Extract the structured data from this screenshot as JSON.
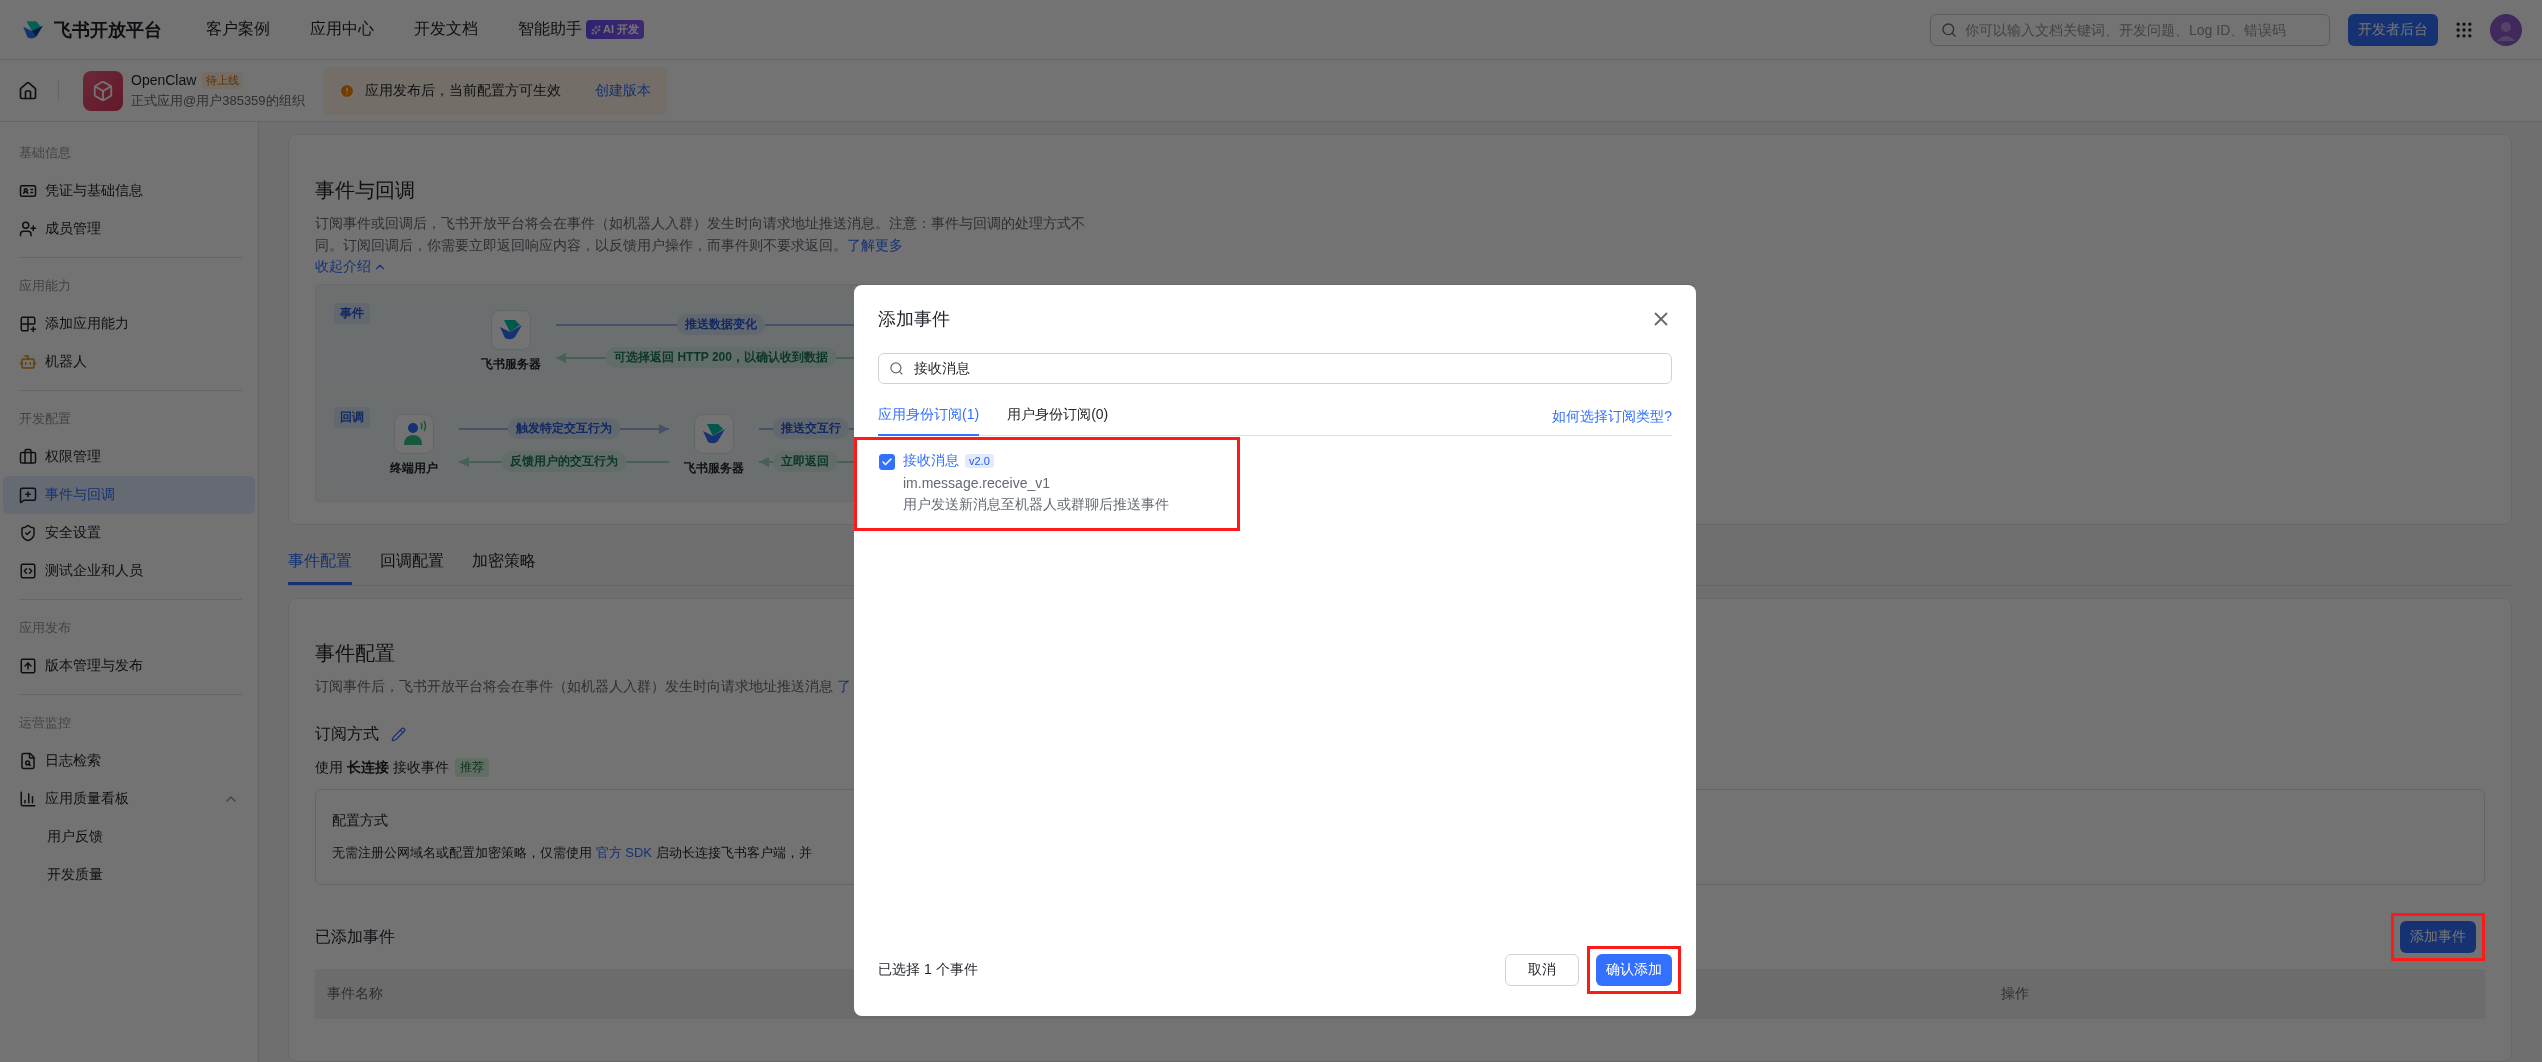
{
  "topbar": {
    "logo": "飞书开放平台",
    "nav": [
      {
        "label": "客户案例"
      },
      {
        "label": "应用中心"
      },
      {
        "label": "开发文档"
      },
      {
        "label": "智能助手",
        "badge": "AI 开发"
      }
    ],
    "search": {
      "placeholder": "你可以输入文档关键词、开发问题、Log ID、错误码"
    },
    "console_button": "开发者后台"
  },
  "app_header": {
    "app_name": "OpenClaw",
    "status": "待上线",
    "org": "正式应用@用户385359的组织",
    "notice": "应用发布后，当前配置方可生效",
    "notice_link": "创建版本"
  },
  "sidebar": {
    "sections": [
      {
        "title": "基础信息",
        "items": [
          {
            "label": "凭证与基础信息",
            "selected": false
          },
          {
            "label": "成员管理",
            "selected": false
          }
        ]
      },
      {
        "title": "应用能力",
        "items": [
          {
            "label": "添加应用能力",
            "selected": false
          },
          {
            "label": "机器人",
            "selected": false
          }
        ]
      },
      {
        "title": "开发配置",
        "items": [
          {
            "label": "权限管理",
            "selected": false
          },
          {
            "label": "事件与回调",
            "selected": true
          },
          {
            "label": "安全设置",
            "selected": false
          },
          {
            "label": "测试企业和人员",
            "selected": false
          }
        ]
      },
      {
        "title": "应用发布",
        "items": [
          {
            "label": "版本管理与发布",
            "selected": false
          }
        ]
      },
      {
        "title": "运营监控",
        "items": [
          {
            "label": "日志检索",
            "selected": false
          },
          {
            "label": "应用质量看板",
            "selected": false,
            "expanded": true,
            "children": [
              {
                "label": "用户反馈",
                "selected": false
              },
              {
                "label": "开发质量",
                "selected": false
              }
            ]
          }
        ]
      }
    ]
  },
  "intro_card": {
    "title": "事件与回调",
    "description": "订阅事件或回调后，飞书开放平台将会在事件（如机器人入群）发生时向请求地址推送消息。注意：事件与回调的处理方式不同。订阅回调后，你需要立即返回响应内容，以反馈用户操作，而事件则不要求返回。",
    "learn_more": "了解更多",
    "collapse_link": "收起介绍",
    "diagram": [
      {
        "tag": "事件",
        "steps": [
          {
            "kind": "server",
            "label": "飞书服务器"
          },
          {
            "kind": "arrows",
            "forward": "推送数据变化",
            "back": "可选择返回 HTTP 200，以确认收到数据"
          }
        ]
      },
      {
        "tag": "回调",
        "steps": [
          {
            "kind": "user",
            "label": "终端用户"
          },
          {
            "kind": "arrows",
            "forward": "触发特定交互行为",
            "back": "反馈用户的交互行为"
          },
          {
            "kind": "server",
            "label": "飞书服务器"
          },
          {
            "kind": "arrows",
            "forward": "推送交互行",
            "back": "立即返回"
          }
        ]
      }
    ]
  },
  "tabs": [
    {
      "label": "事件配置",
      "selected": true
    },
    {
      "label": "回调配置",
      "selected": false
    },
    {
      "label": "加密策略",
      "selected": false
    }
  ],
  "event_config": {
    "title": "事件配置",
    "description": "订阅事件后，飞书开放平台将会在事件（如机器人入群）发生时向请求地址推送消息 ",
    "description_link": "了",
    "subscription_title": "订阅方式",
    "mode": "使用 **长连接** 接收事件",
    "mode_badge": "推荐",
    "config_box": {
      "title": "配置方式",
      "text_before": "无需注册公网域名或配置加密策略，仅需使用 ",
      "link": "官方 SDK",
      "text_after": " 启动长连接飞书客户端，并"
    },
    "added_title": "已添加事件",
    "add_button": {
      "label": "添加事件",
      "highlighted": true
    },
    "table": {
      "columns": [
        "事件名称",
        "操作"
      ]
    }
  },
  "modal": {
    "title": "添加事件",
    "search": {
      "value": "接收消息"
    },
    "tabs": [
      {
        "label": "应用身份订阅(1)",
        "selected": true
      },
      {
        "label": "用户身份订阅(0)",
        "selected": false
      }
    ],
    "help_link": "如何选择订阅类型?",
    "events": [
      {
        "name": "接收消息",
        "version": "v2.0",
        "key": "im.message.receive_v1",
        "description": "用户发送新消息至机器人或群聊后推送事件",
        "checked": true,
        "highlighted": true
      }
    ],
    "selected_count": "已选择 1 个事件",
    "cancel": "取消",
    "confirm": {
      "label": "确认添加",
      "highlighted": true
    }
  }
}
